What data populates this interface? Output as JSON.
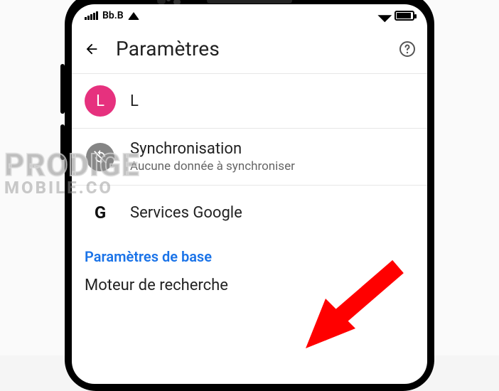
{
  "statusbar": {
    "carrier": "Bb.B"
  },
  "header": {
    "title": "Paramètres"
  },
  "account": {
    "avatar_initial": "L",
    "name": "L"
  },
  "rows": {
    "sync": {
      "label": "Synchronisation",
      "sub": "Aucune donnée à synchroniser"
    },
    "google_services": {
      "label": "Services Google"
    }
  },
  "section": {
    "basic": "Paramètres de base"
  },
  "search_engine": {
    "label": "Moteur de recherche"
  },
  "watermark": {
    "line1": "PRODIGE",
    "line2": "MOBILE.CO"
  }
}
